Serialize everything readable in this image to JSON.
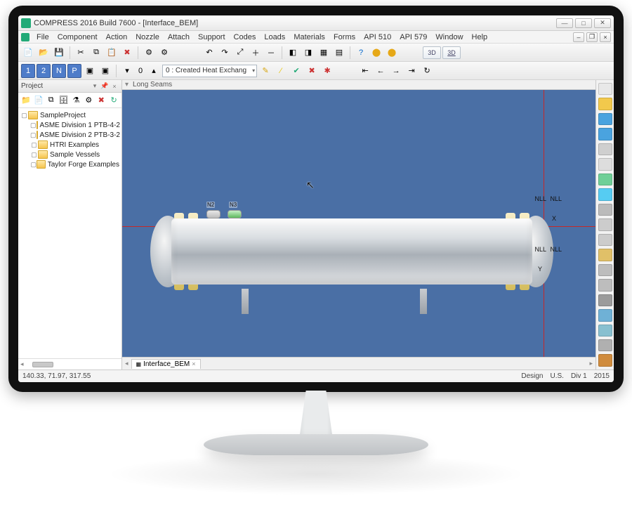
{
  "window": {
    "title": "COMPRESS 2016 Build 7600 - [Interface_BEM]"
  },
  "menu": {
    "items": [
      "File",
      "Component",
      "Action",
      "Nozzle",
      "Attach",
      "Support",
      "Codes",
      "Loads",
      "Materials",
      "Forms",
      "API 510",
      "API 579",
      "Window",
      "Help"
    ]
  },
  "toolbar": {
    "rev_badges": [
      "1",
      "2",
      "N",
      "P"
    ],
    "rev_sel": "0",
    "combo": "0 : Created Heat Exchang",
    "view3d": "3D",
    "view3d_wire": "3D"
  },
  "project_panel": {
    "title": "Project",
    "root": "SampleProject",
    "children": [
      "ASME Division 1 PTB-4-2",
      "ASME Division 2 PTB-3-2",
      "HTRI Examples",
      "Sample Vessels",
      "Taylor Forge Examples"
    ]
  },
  "viewport": {
    "header": "Long Seams",
    "labels": {
      "n2": "N2",
      "n3": "N3",
      "nll": "NLL",
      "x": "X",
      "y": "Y"
    }
  },
  "doc_tab": {
    "label": "Interface_BEM"
  },
  "status": {
    "coords": "140.33, 71.97, 317.55",
    "mode": "Design",
    "units": "U.S.",
    "div": "Div 1",
    "year": "2015"
  },
  "palette_colors": [
    "#e8e8e8",
    "#f2c94c",
    "#4aa3df",
    "#4aa3df",
    "#cfcfcf",
    "#dddddd",
    "#6fcf97",
    "#56ccf2",
    "#bbbbbb",
    "#cccccc",
    "#cccccc",
    "#e0c068",
    "#bdbdbd",
    "#bdbdbd",
    "#9b9b9b",
    "#6fb1d6",
    "#88c0d0",
    "#b0b0b0",
    "#d08c3e"
  ]
}
